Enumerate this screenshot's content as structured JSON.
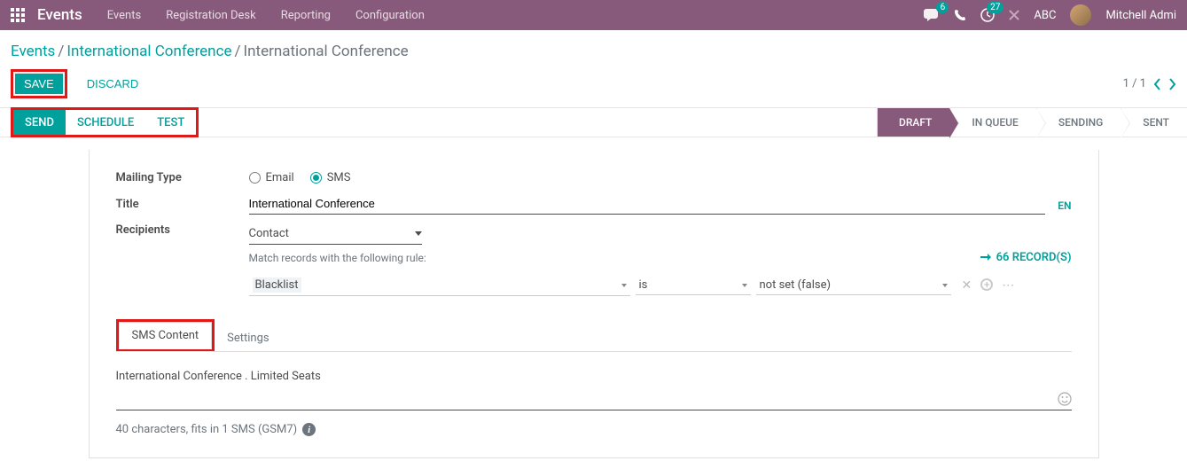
{
  "topbar": {
    "brand": "Events",
    "menu": [
      "Events",
      "Registration Desk",
      "Reporting",
      "Configuration"
    ],
    "chat_badge": "6",
    "clock_badge": "27",
    "company": "ABC",
    "user": "Mitchell Admi"
  },
  "breadcrumb": {
    "root": "Events",
    "parent": "International Conference",
    "current": "International Conference"
  },
  "actions": {
    "save": "SAVE",
    "discard": "DISCARD",
    "pager": "1 / 1"
  },
  "statusbar": {
    "send": "SEND",
    "schedule": "SCHEDULE",
    "test": "TEST",
    "stages": [
      "DRAFT",
      "IN QUEUE",
      "SENDING",
      "SENT"
    ]
  },
  "form": {
    "mailing_type_label": "Mailing Type",
    "radio_email": "Email",
    "radio_sms": "SMS",
    "title_label": "Title",
    "title_value": "International Conference",
    "lang": "EN",
    "recipients_label": "Recipients",
    "recipients_value": "Contact",
    "rule_text": "Match records with the following rule:",
    "records_link": "66 RECORD(S)",
    "filter_field": "Blacklist",
    "filter_op": "is",
    "filter_val": "not set (false)"
  },
  "tabs": {
    "sms_content": "SMS Content",
    "settings": "Settings"
  },
  "sms": {
    "body": "International Conference . Limited Seats",
    "meta": "40 characters, fits in 1 SMS (GSM7)"
  }
}
